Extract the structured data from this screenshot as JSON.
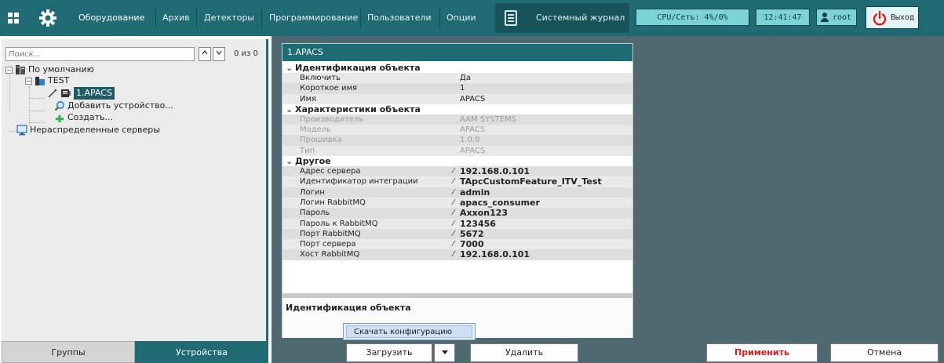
{
  "topbar": {
    "tabs": [
      {
        "label": "Оборудование"
      },
      {
        "label": "Архив"
      },
      {
        "label": "Детекторы"
      },
      {
        "label": "Программирование"
      },
      {
        "label": "Пользователи"
      },
      {
        "label": "Опции"
      }
    ],
    "journal_label": "Системный журнал",
    "cpu_status": "CPU/Сеть: 4%/0%",
    "clock": "12:41:47",
    "user": "root",
    "exit_label": "Выход",
    "icons": {
      "apps": "apps-grid-icon",
      "settings": "gear-icon",
      "journal": "journal-icon",
      "user": "user-icon",
      "exit": "power-icon"
    }
  },
  "left": {
    "search_placeholder": "Поиск...",
    "search_count": "0 из 0",
    "tree": {
      "root": "По умолчанию",
      "test": "TEST",
      "selected": "1.APACS",
      "add_device": "Добавить устройство...",
      "create": "Создать...",
      "unassigned": "Нераспределенные серверы"
    },
    "tabs": {
      "groups": "Группы",
      "devices": "Устройства"
    }
  },
  "props": {
    "title": "1.APACS",
    "groups": [
      {
        "label": "Идентификация объекта",
        "rows": [
          {
            "name": "Включить",
            "value": "Да",
            "disabled": false,
            "editable": false
          },
          {
            "name": "Короткое имя",
            "value": "1",
            "disabled": false,
            "editable": false
          },
          {
            "name": "Имя",
            "value": "APACS",
            "disabled": false,
            "editable": false
          }
        ]
      },
      {
        "label": "Характеристики объекта",
        "rows": [
          {
            "name": "Производитель",
            "value": "AAM SYSTEMS",
            "disabled": true,
            "editable": false
          },
          {
            "name": "Модель",
            "value": "APACS",
            "disabled": true,
            "editable": false
          },
          {
            "name": "Прошивка",
            "value": "1.0.0",
            "disabled": true,
            "editable": false
          },
          {
            "name": "Тип",
            "value": "APACS",
            "disabled": true,
            "editable": false
          }
        ]
      },
      {
        "label": "Другое",
        "rows": [
          {
            "name": "Адрес сервера",
            "value": "192.168.0.101",
            "disabled": false,
            "editable": true
          },
          {
            "name": "Идентификатор интеграции",
            "value": "TApcCustomFeature_ITV_Test",
            "disabled": false,
            "editable": true
          },
          {
            "name": "Логин",
            "value": "admin",
            "disabled": false,
            "editable": true
          },
          {
            "name": "Логин RabbitMQ",
            "value": "apacs_consumer",
            "disabled": false,
            "editable": true
          },
          {
            "name": "Пароль",
            "value": "Axxon123",
            "disabled": false,
            "editable": true
          },
          {
            "name": "Пароль к RabbitMQ",
            "value": "123456",
            "disabled": false,
            "editable": true
          },
          {
            "name": "Порт RabbitMQ",
            "value": "5672",
            "disabled": false,
            "editable": true
          },
          {
            "name": "Порт сервера",
            "value": "7000",
            "disabled": false,
            "editable": true
          },
          {
            "name": "Хост RabbitMQ",
            "value": "192.168.0.101",
            "disabled": false,
            "editable": true
          }
        ]
      }
    ],
    "description_title": "Идентификация объекта"
  },
  "actions": {
    "dropdown_item": "Скачать конфигурацию",
    "load": "Загрузить",
    "delete": "Удалить",
    "apply": "Применить",
    "cancel": "Отмена"
  },
  "colors": {
    "accent": "#1f6a73",
    "apply_text": "#e01b1b",
    "exit_icon": "#e01b1b"
  }
}
